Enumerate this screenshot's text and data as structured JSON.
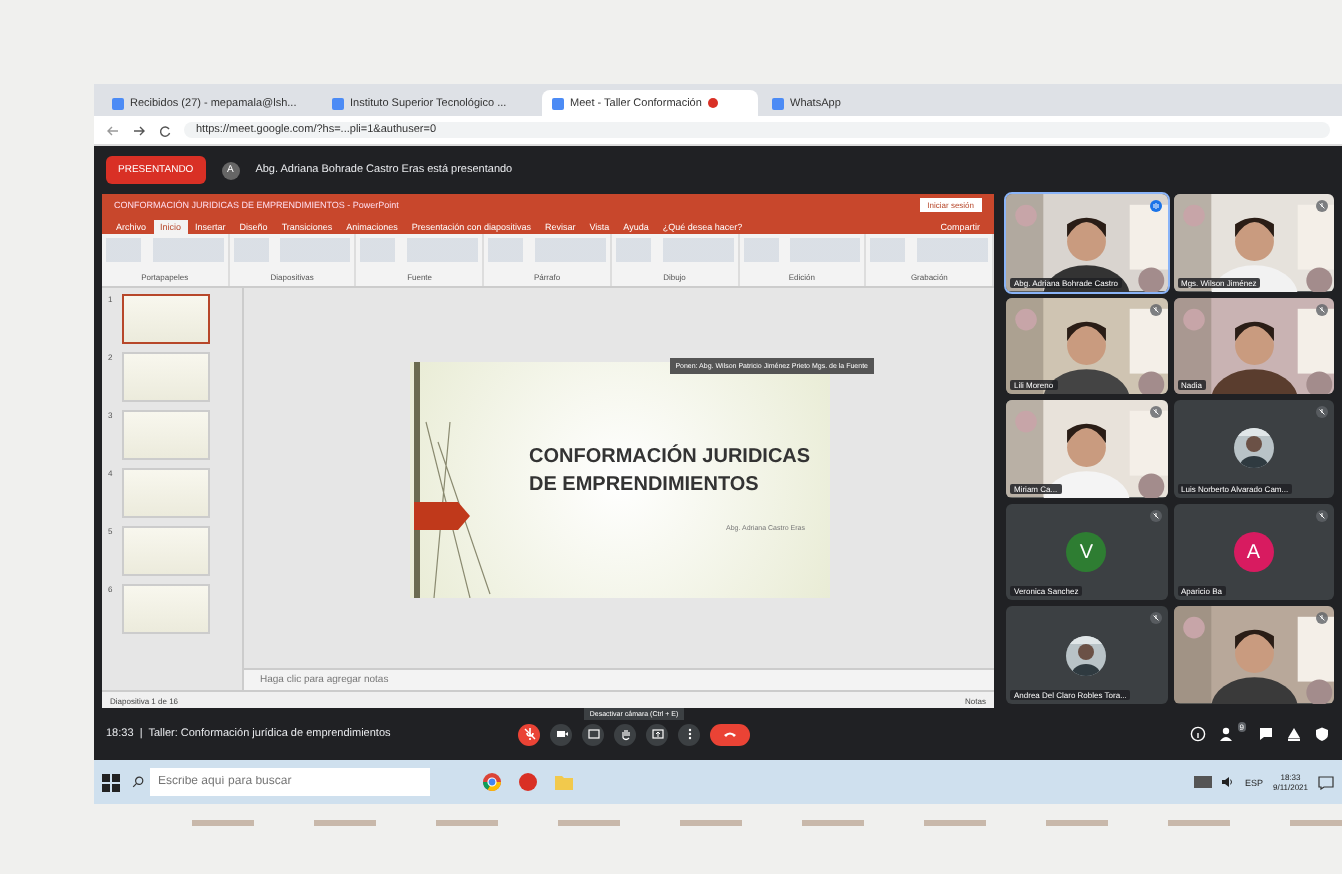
{
  "browser": {
    "tabs": [
      {
        "title": "Recibidos (27) - mepamala@lsh...",
        "selected": false
      },
      {
        "title": "Instituto Superior Tecnológico ...",
        "selected": false
      },
      {
        "title": "Meet - Taller Conformación",
        "selected": true,
        "recording": true
      },
      {
        "title": "WhatsApp",
        "selected": false
      }
    ],
    "url": "https://meet.google.com/?hs=...pli=1&authuser=0"
  },
  "meet": {
    "presenting_button": "PRESENTANDO",
    "presenter_initial": "A",
    "presenter_text": "Abg. Adriana Bohrade Castro Eras está presentando",
    "powerpoint": {
      "title": "CONFORMACIÓN JURIDICAS DE EMPRENDIMIENTOS - PowerPoint",
      "signin": "Iniciar sesión",
      "ribbon_tabs": [
        {
          "label": "Archivo",
          "selected": false
        },
        {
          "label": "Inicio",
          "selected": true
        },
        {
          "label": "Insertar",
          "selected": false
        },
        {
          "label": "Diseño",
          "selected": false
        },
        {
          "label": "Transiciones",
          "selected": false
        },
        {
          "label": "Animaciones",
          "selected": false
        },
        {
          "label": "Presentación con diapositivas",
          "selected": false
        },
        {
          "label": "Revisar",
          "selected": false
        },
        {
          "label": "Vista",
          "selected": false
        },
        {
          "label": "Ayuda",
          "selected": false
        },
        {
          "label": "¿Qué desea hacer?",
          "selected": false
        }
      ],
      "share": "Compartir",
      "ribbon_groups": [
        "Portapapeles",
        "Diapositivas",
        "Fuente",
        "Párrafo",
        "Dibujo",
        "Edición",
        "Grabación"
      ],
      "thumbnails": [
        {
          "number": "1",
          "selected": true
        },
        {
          "number": "2",
          "selected": false
        },
        {
          "number": "3",
          "selected": false
        },
        {
          "number": "4",
          "selected": false
        },
        {
          "number": "5",
          "selected": false
        },
        {
          "number": "6",
          "selected": false
        }
      ],
      "slide": {
        "title_lines": [
          "CONFORMACIÓN JURIDICAS",
          "DE EMPRENDIMIENTOS"
        ],
        "author": "Abg. Adriana Castro Eras"
      },
      "speaker_tag": "Ponen: Abg. Wilson Patricio Jiménez Prieto Mgs. de la Fuente",
      "notes_placeholder": "Haga clic para agregar notas",
      "status": "Diapositiva 1 de 16",
      "status_notes": "Notas"
    },
    "participants": [
      {
        "name": "Abg. Adriana Bohrade Castro",
        "kind": "video",
        "speaking": true
      },
      {
        "name": "Mgs. Wilson Jiménez",
        "kind": "video",
        "speaking": false
      },
      {
        "name": "Lili Moreno",
        "kind": "video",
        "speaking": false
      },
      {
        "name": "Nadia",
        "kind": "video",
        "speaking": false
      },
      {
        "name": "Miriam Ca...",
        "kind": "video",
        "speaking": false
      },
      {
        "name": "Luis Norberto Alvarado Cam...",
        "speaking": false
      },
      {
        "name": "Veronica Sanchez",
        "kind": "avatar",
        "letter": "V",
        "color": "#2e7d32",
        "speaking": false
      },
      {
        "name": "Aparicio Ba",
        "kind": "avatar",
        "letter": "A",
        "color": "#d81b60",
        "speaking": false
      },
      {
        "name": "Andrea Del Claro Robles Tora...",
        "speaking": false
      },
      {
        "kind": "video",
        "speaking": false
      }
    ],
    "meeting_info": "18:33  |  Taller: Conformación jurídica de emprendimientos",
    "tooltip": "Desactivar cámara (Ctrl + E)",
    "controls": [
      {
        "kind": "mic",
        "alert": true
      },
      {
        "kind": "camera",
        "alert": false
      },
      {
        "kind": "captions",
        "alert": false
      },
      {
        "kind": "hand",
        "alert": false
      },
      {
        "kind": "present",
        "alert": false
      },
      {
        "kind": "more",
        "alert": false
      },
      {
        "kind": "hangup",
        "alert": true
      }
    ],
    "participant_count": "9"
  },
  "taskbar": {
    "search_placeholder": "Escribe aquí para buscar",
    "language": "ESP",
    "time": "18:33",
    "date": "9/11/2021"
  }
}
